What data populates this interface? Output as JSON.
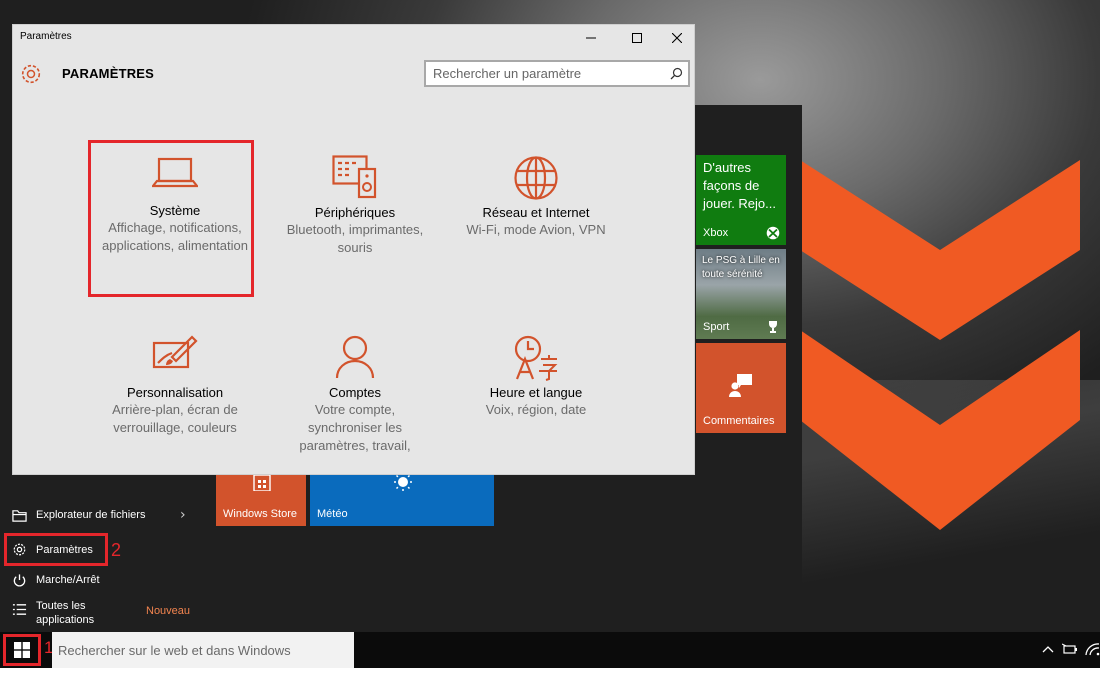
{
  "window": {
    "title": "Paramètres",
    "header": "PARAMÈTRES",
    "search_placeholder": "Rechercher un paramètre"
  },
  "categories": [
    {
      "name": "Système",
      "desc": "Affichage, notifications, applications, alimentation",
      "icon": "laptop-icon"
    },
    {
      "name": "Périphériques",
      "desc": "Bluetooth, imprimantes, souris",
      "icon": "devices-icon"
    },
    {
      "name": "Réseau et Internet",
      "desc": "Wi-Fi, mode Avion, VPN",
      "icon": "globe-icon"
    },
    {
      "name": "Personnalisation",
      "desc": "Arrière-plan, écran de verrouillage, couleurs",
      "icon": "paint-icon"
    },
    {
      "name": "Comptes",
      "desc": "Votre compte, synchroniser les paramètres, travail,",
      "icon": "person-icon"
    },
    {
      "name": "Heure et langue",
      "desc": "Voix, région, date",
      "icon": "time-language-icon"
    }
  ],
  "start_menu": {
    "items": [
      {
        "label": "Explorateur de fichiers",
        "icon": "folder-icon"
      },
      {
        "label": "Paramètres",
        "icon": "gear-icon"
      },
      {
        "label": "Marche/Arrêt",
        "icon": "power-icon"
      },
      {
        "label_line1": "Toutes les",
        "label_line2": "applications",
        "icon": "list-icon"
      }
    ],
    "new_badge": "Nouveau",
    "annotation_1": "1",
    "annotation_2": "2"
  },
  "tiles": {
    "store": "Windows Store",
    "meteo": "Météo",
    "xbox_text": "D'autres façons de jouer. Rejo...",
    "xbox_label": "Xbox",
    "sport_text": "Le PSG à Lille en toute sérénité",
    "sport_label": "Sport",
    "comments": "Commentaires"
  },
  "taskbar": {
    "search_placeholder": "Rechercher sur le web et dans Windows"
  },
  "colors": {
    "accent": "#d2532c",
    "highlight": "#e4262b",
    "xbox_green": "#107c10",
    "meteo_blue": "#0a6bbd"
  }
}
